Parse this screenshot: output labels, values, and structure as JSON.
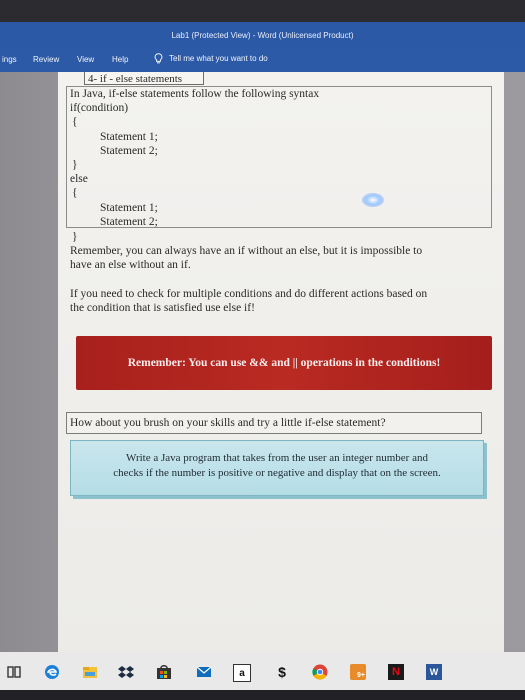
{
  "window": {
    "title": "Lab1 (Protected View) - Word (Unlicensed Product)"
  },
  "ribbon": {
    "tabs": [
      "ings",
      "Review",
      "View",
      "Help"
    ],
    "tell_me": "Tell me what you want to do"
  },
  "document": {
    "section_heading": "4- if - else statements",
    "intro": "In Java, if-else statements follow the following syntax",
    "syntax_lines": [
      "if(condition)",
      "{",
      "Statement 1;",
      "Statement 2;",
      "}",
      "else",
      "{",
      "Statement 1;",
      "Statement 2;",
      "}"
    ],
    "note1_line1": "Remember, you can always have an if without an else, but it is impossible to",
    "note1_line2": "have an else without an if.",
    "note2_line1": "If you need to check for multiple conditions and do different actions based on",
    "note2_line2": "the condition that is satisfied use else if!",
    "banner": "Remember: You can use && and || operations in the conditions!",
    "question": "How about you brush on your skills and try a little if-else statement?",
    "task_line1": "Write a Java program that takes from the user an integer number and",
    "task_line2": "checks if the number is positive or negative and display that on the screen."
  },
  "taskbar": {
    "icons": [
      "task-view-icon",
      "edge-icon",
      "file-explorer-icon",
      "dropbox-icon",
      "store-icon",
      "mail-icon",
      "amazon-icon",
      "dollar-icon",
      "chrome-icon",
      "game-icon",
      "netflix-icon",
      "word-icon"
    ],
    "amazon_letter": "a",
    "dollar_glyph": "$",
    "netflix_letter": "N",
    "word_letter": "W",
    "game_badge": "9+"
  },
  "colors": {
    "word_blue": "#2c59a6",
    "banner_red": "#b12420",
    "task_box": "#c4e3ea"
  }
}
